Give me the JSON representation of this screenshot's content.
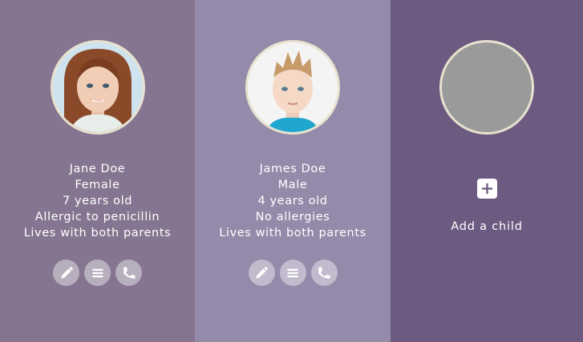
{
  "children": [
    {
      "name": "Jane Doe",
      "gender": "Female",
      "age": "7 years old",
      "allergies": "Allergic to penicillin",
      "living": "Lives with both parents"
    },
    {
      "name": "James Doe",
      "gender": "Male",
      "age": "4 years old",
      "allergies": "No allergies",
      "living": "Lives with both parents"
    }
  ],
  "add_child": {
    "label": "Add a child"
  },
  "icons": {
    "edit": "pencil-icon",
    "details": "list-icon",
    "call": "phone-icon",
    "add": "plus-icon"
  },
  "colors": {
    "panel_1": "#857590",
    "panel_2": "#948aa9",
    "panel_3": "#6c5a80",
    "avatar_ring": "#e6e2cf",
    "placeholder_avatar": "#9a9a9a"
  }
}
